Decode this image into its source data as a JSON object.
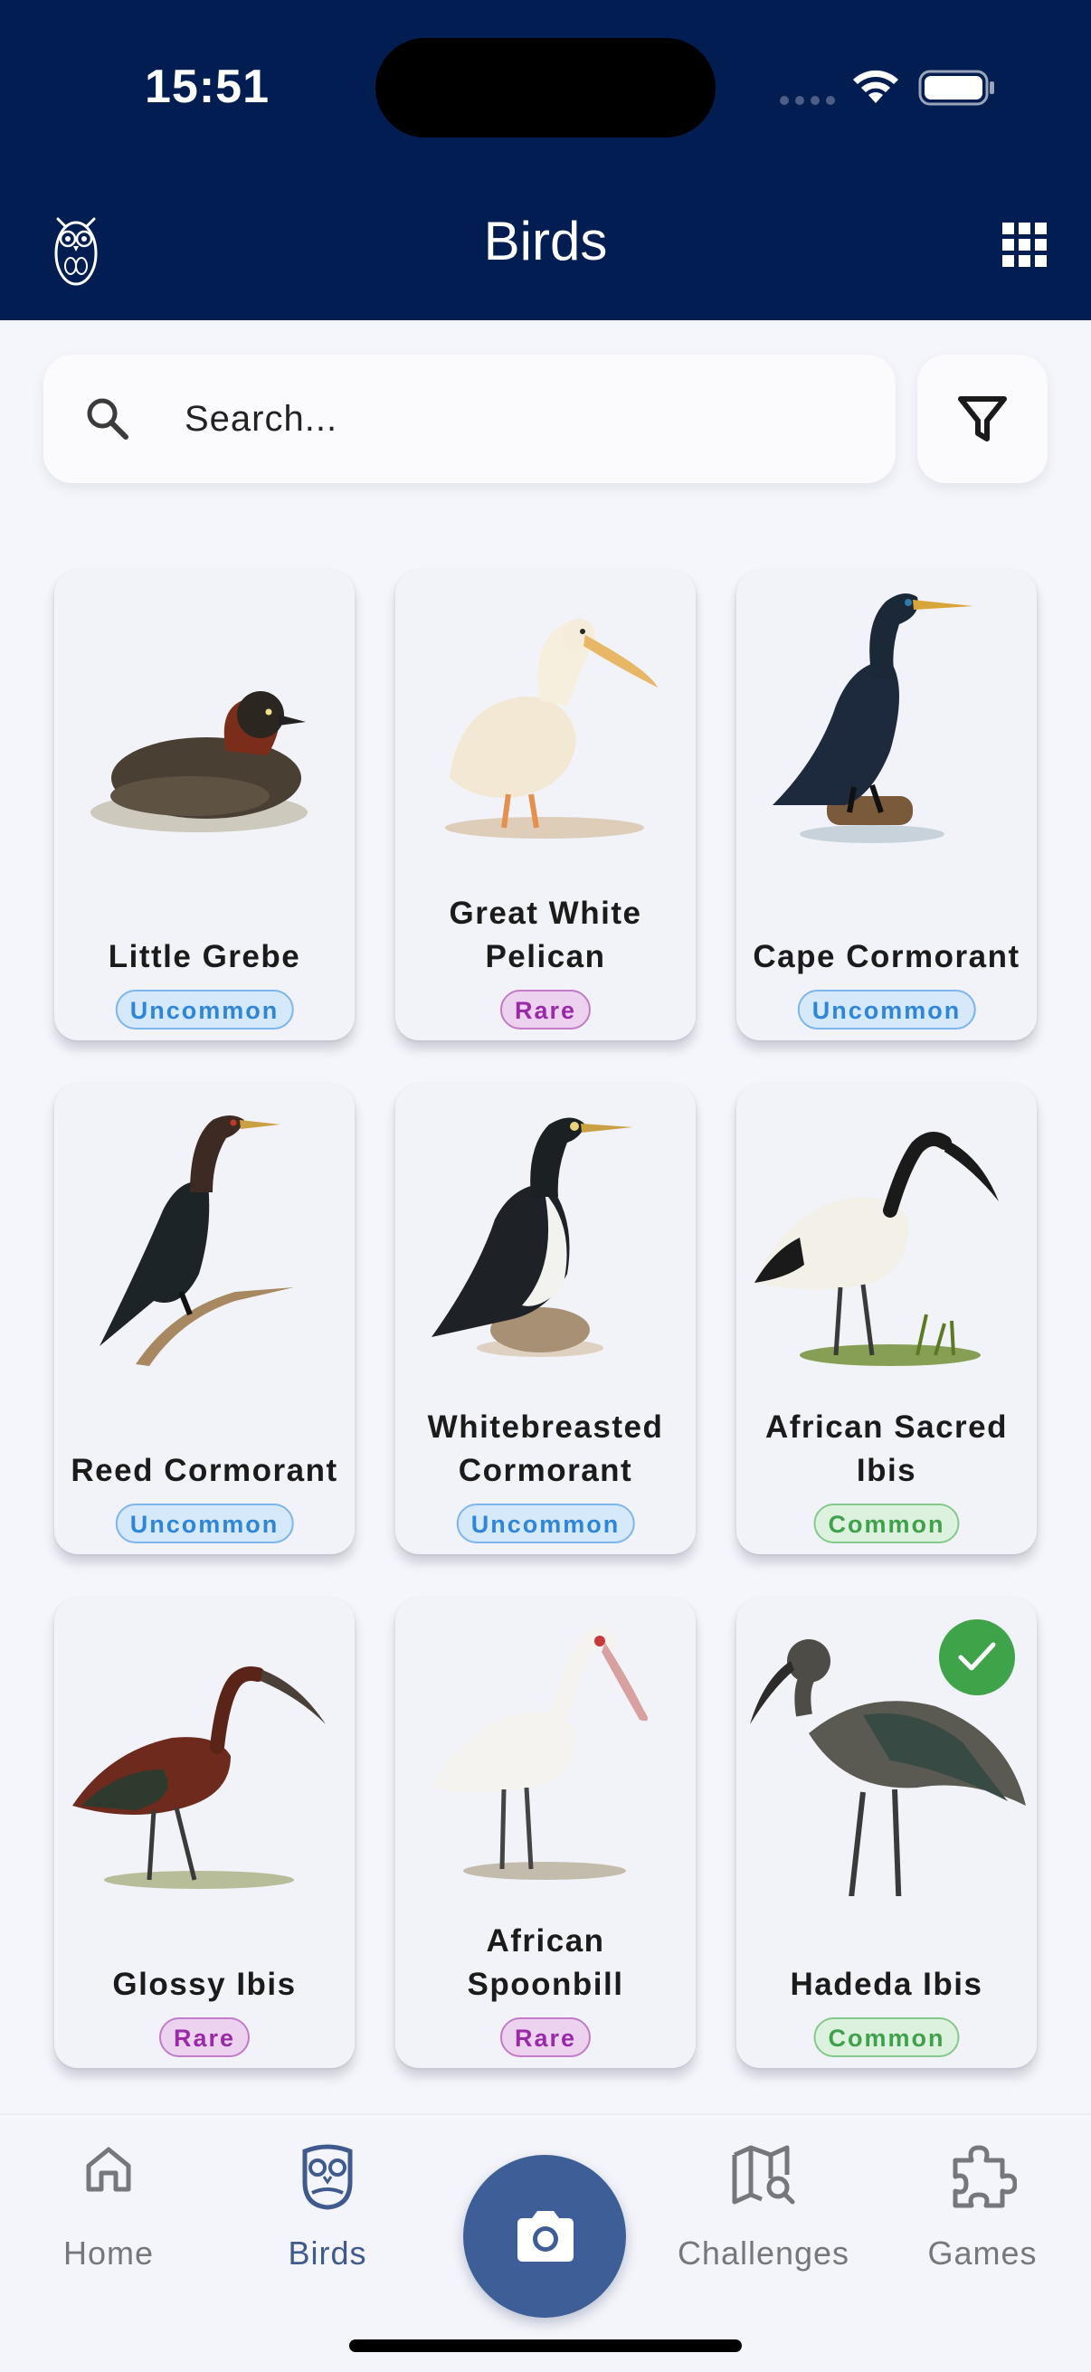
{
  "status_bar": {
    "time": "15:51"
  },
  "header": {
    "title": "Birds"
  },
  "search": {
    "placeholder": "Search..."
  },
  "birds": [
    {
      "name": "Little Grebe",
      "rarity": "Uncommon"
    },
    {
      "name": "Great White Pelican",
      "rarity": "Rare"
    },
    {
      "name": "Cape Cormorant",
      "rarity": "Uncommon"
    },
    {
      "name": "Reed Cormorant",
      "rarity": "Uncommon"
    },
    {
      "name": "Whitebreasted Cormorant",
      "rarity": "Uncommon"
    },
    {
      "name": "African Sacred Ibis",
      "rarity": "Common"
    },
    {
      "name": "Glossy Ibis",
      "rarity": "Rare"
    },
    {
      "name": "African Spoonbill",
      "rarity": "Rare"
    },
    {
      "name": "Hadeda Ibis",
      "rarity": "Common",
      "seen": true
    }
  ],
  "bottom_nav": {
    "home": "Home",
    "birds": "Birds",
    "challenges": "Challenges",
    "games": "Games",
    "active": "Birds"
  },
  "colors": {
    "header_bg": "#021d52",
    "accent": "#3e5e98",
    "uncommon": "#2f86d8",
    "rare": "#9a2aa8",
    "common": "#3fa24a"
  },
  "icons": {
    "logo": "owl-logo-icon",
    "grid": "grid-icon",
    "search": "search-icon",
    "filter": "filter-icon",
    "seen": "check-icon",
    "camera": "camera-icon"
  }
}
